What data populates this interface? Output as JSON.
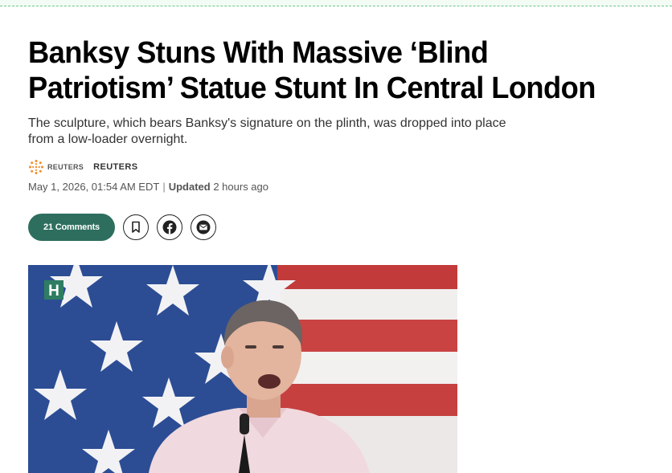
{
  "article": {
    "headline_line1": "Banksy Stuns With Massive ‘Blind",
    "headline_line2": "Patriotism’ Statue Stunt In Central London",
    "subhead": "The sculpture, which bears Banksy's signature on the plinth, was dropped into place from a low-loader overnight.",
    "source_logo_text": "REUTERS",
    "author": "REUTERS",
    "published": "May 1, 2026, 01:54 AM EDT",
    "separator": "|",
    "updated_label": "Updated",
    "updated_value": "2 hours ago"
  },
  "actions": {
    "comments_label": "21 Comments",
    "bookmark_icon": "bookmark-icon",
    "facebook_icon": "facebook-icon",
    "email_icon": "email-icon"
  },
  "image": {
    "badge_letter": "H",
    "badge_color": "#2e7d62"
  },
  "colors": {
    "accent": "#2e6e5e",
    "flag_blue": "#2b4a8c",
    "flag_red": "#c0392b"
  }
}
